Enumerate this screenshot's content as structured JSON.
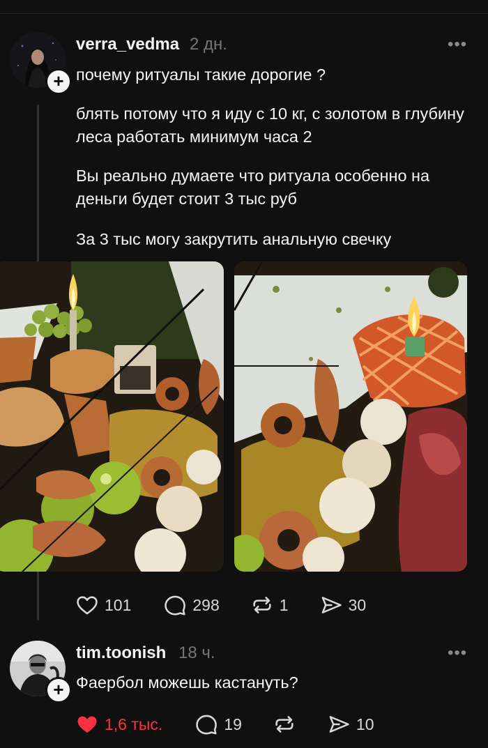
{
  "post": {
    "username": "verra_vedma",
    "time": "2 дн.",
    "paragraphs": [
      "почему ритуалы такие дорогие ?",
      "блять потому что я иду с 10 кг, с золотом в глубину леса работать минимум часа 2",
      "Вы реально думаете что ритуала особенно на деньги будет стоит 3 тыс руб",
      "За 3 тыс могу закрутить анальную свечку"
    ],
    "actions": {
      "likes": "101",
      "comments": "298",
      "reposts": "1",
      "shares": "30"
    }
  },
  "reply": {
    "username": "tim.toonish",
    "time": "18 ч.",
    "text": "Фаербол можешь кастануть?",
    "actions": {
      "likes": "1,6 тыс.",
      "comments": "19",
      "shares": "10"
    }
  },
  "icons": {
    "more": "more-dots-icon",
    "follow": "plus-icon",
    "like": "heart-icon",
    "comment": "comment-bubble-icon",
    "repost": "repost-icon",
    "share": "send-icon"
  },
  "colors": {
    "background": "#101010",
    "text": "#f3f5f7",
    "muted": "#777777",
    "liked": "#ff3040"
  }
}
